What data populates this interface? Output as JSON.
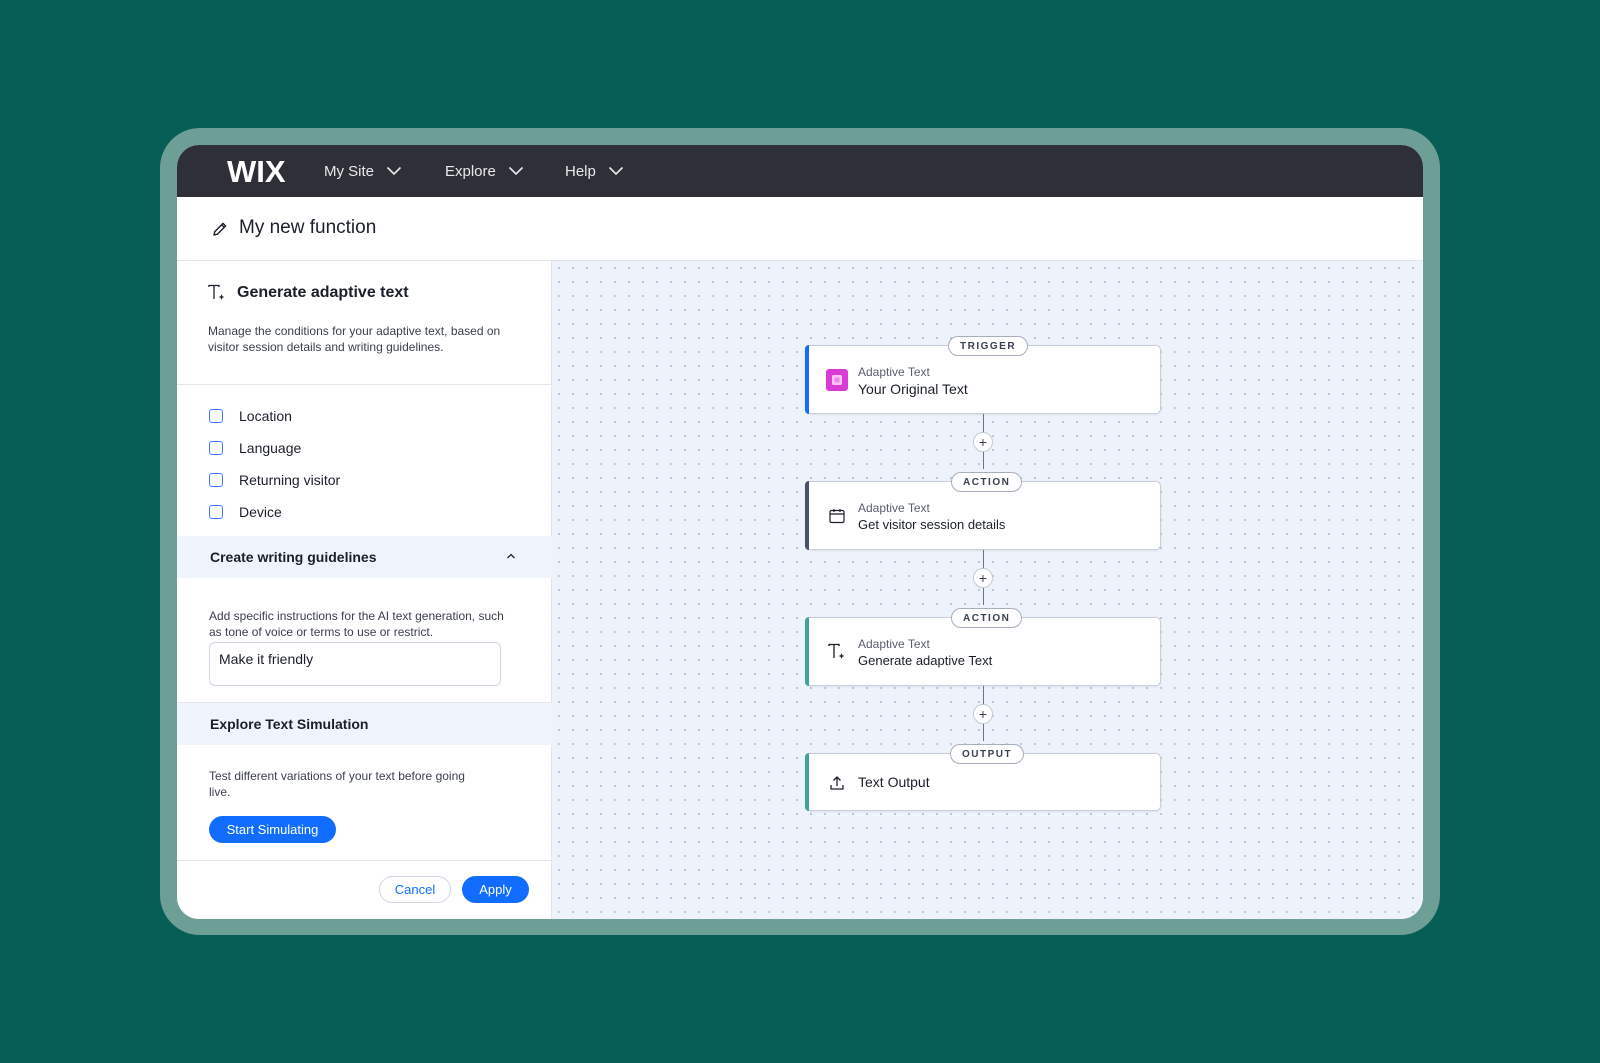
{
  "nav": {
    "logo": "WIX",
    "items": [
      {
        "label": "My Site"
      },
      {
        "label": "Explore"
      },
      {
        "label": "Help"
      }
    ]
  },
  "header": {
    "title": "My new function"
  },
  "panel": {
    "title": "Generate adaptive text",
    "description": "Manage the conditions for your adaptive text, based on visitor session details and writing guidelines.",
    "conditions": [
      "Location",
      "Language",
      "Returning visitor",
      "Device"
    ],
    "guidelines": {
      "heading": "Create writing guidelines",
      "description": "Add specific instructions for the AI text generation, such as tone of voice or terms to use or restrict.",
      "input_value": "Make it friendly"
    },
    "simulation": {
      "heading": "Explore Text Simulation",
      "description": "Test different variations of your text before going live.",
      "button": "Start Simulating"
    },
    "footer": {
      "cancel": "Cancel",
      "apply": "Apply"
    }
  },
  "flow": {
    "nodes": [
      {
        "badge": "TRIGGER",
        "sub": "Adaptive Text",
        "main": "Your Original Text",
        "icon": "adaptive-text-app-icon",
        "accent": "#116dff"
      },
      {
        "badge": "ACTION",
        "sub": "Adaptive Text",
        "main": "Get visitor session details",
        "icon": "calendar-icon",
        "accent": "#4a5266"
      },
      {
        "badge": "ACTION",
        "sub": "Adaptive Text",
        "main": "Generate adaptive Text",
        "icon": "text-sparkle-icon",
        "accent": "#3fa39a"
      },
      {
        "badge": "OUTPUT",
        "main": "Text Output",
        "icon": "upload-icon",
        "accent": "#3fa39a"
      }
    ],
    "add_step_label": "+"
  },
  "colors": {
    "page_bg": "#065e57",
    "frame": "#6e9f97",
    "topbar": "#2f3037",
    "primary": "#116dff",
    "canvas_bg": "#eef3fb"
  }
}
